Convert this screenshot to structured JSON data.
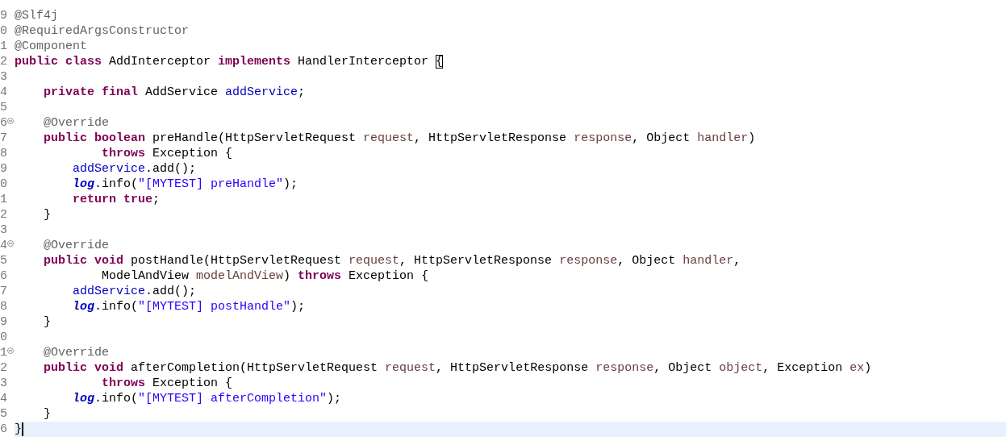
{
  "editor": {
    "lines": [
      {
        "number": "9",
        "tokens": [
          {
            "kind": "annotation",
            "text": "@Slf4j"
          }
        ]
      },
      {
        "number": "0",
        "tokens": [
          {
            "kind": "annotation",
            "text": "@RequiredArgsConstructor"
          }
        ]
      },
      {
        "number": "1",
        "tokens": [
          {
            "kind": "annotation",
            "text": "@Component"
          }
        ]
      },
      {
        "number": "2",
        "tokens": [
          {
            "kind": "keyword",
            "text": "public class"
          },
          {
            "kind": "plain",
            "text": " AddInterceptor "
          },
          {
            "kind": "keyword",
            "text": "implements"
          },
          {
            "kind": "plain",
            "text": " HandlerInterceptor "
          },
          {
            "kind": "matched_bracket",
            "text": "{"
          }
        ]
      },
      {
        "number": "3"
      },
      {
        "number": "4",
        "tokens": [
          {
            "kind": "keyword",
            "text": "    private final"
          },
          {
            "kind": "plain",
            "text": " AddService "
          },
          {
            "kind": "field",
            "text": "addService"
          },
          {
            "kind": "plain",
            "text": ";"
          }
        ]
      },
      {
        "number": "5"
      },
      {
        "number": "6",
        "collapsible": true,
        "tokens": [
          {
            "kind": "annotation",
            "text": "    @Override"
          }
        ]
      },
      {
        "number": "7",
        "tokens": [
          {
            "kind": "keyword",
            "text": "    public boolean"
          },
          {
            "kind": "plain",
            "text": " preHandle(HttpServletRequest "
          },
          {
            "kind": "param",
            "text": "request"
          },
          {
            "kind": "plain",
            "text": ", HttpServletResponse "
          },
          {
            "kind": "param",
            "text": "response"
          },
          {
            "kind": "plain",
            "text": ", Object "
          },
          {
            "kind": "param",
            "text": "handler"
          },
          {
            "kind": "plain",
            "text": ")"
          }
        ]
      },
      {
        "number": "8",
        "tokens": [
          {
            "kind": "keyword",
            "text": "            throws"
          },
          {
            "kind": "plain",
            "text": " Exception {"
          }
        ]
      },
      {
        "number": "9",
        "tokens": [
          {
            "kind": "field",
            "text": "        addService"
          },
          {
            "kind": "plain",
            "text": ".add();"
          }
        ]
      },
      {
        "number": "0",
        "tokens": [
          {
            "kind": "static",
            "text": "        log"
          },
          {
            "kind": "plain",
            "text": ".info("
          },
          {
            "kind": "string",
            "text": "\"[MYTEST] preHandle\""
          },
          {
            "kind": "plain",
            "text": ");"
          }
        ]
      },
      {
        "number": "1",
        "tokens": [
          {
            "kind": "keyword",
            "text": "        return true"
          },
          {
            "kind": "plain",
            "text": ";"
          }
        ]
      },
      {
        "number": "2",
        "tokens": [
          {
            "kind": "plain",
            "text": "    }"
          }
        ]
      },
      {
        "number": "3"
      },
      {
        "number": "4",
        "collapsible": true,
        "tokens": [
          {
            "kind": "annotation",
            "text": "    @Override"
          }
        ]
      },
      {
        "number": "5",
        "tokens": [
          {
            "kind": "keyword",
            "text": "    public void"
          },
          {
            "kind": "plain",
            "text": " postHandle(HttpServletRequest "
          },
          {
            "kind": "param",
            "text": "request"
          },
          {
            "kind": "plain",
            "text": ", HttpServletResponse "
          },
          {
            "kind": "param",
            "text": "response"
          },
          {
            "kind": "plain",
            "text": ", Object "
          },
          {
            "kind": "param",
            "text": "handler"
          },
          {
            "kind": "plain",
            "text": ","
          }
        ]
      },
      {
        "number": "6",
        "tokens": [
          {
            "kind": "plain",
            "text": "            ModelAndView "
          },
          {
            "kind": "param",
            "text": "modelAndView"
          },
          {
            "kind": "plain",
            "text": ") "
          },
          {
            "kind": "keyword",
            "text": "throws"
          },
          {
            "kind": "plain",
            "text": " Exception {"
          }
        ]
      },
      {
        "number": "7",
        "tokens": [
          {
            "kind": "field",
            "text": "        addService"
          },
          {
            "kind": "plain",
            "text": ".add();"
          }
        ]
      },
      {
        "number": "8",
        "tokens": [
          {
            "kind": "static",
            "text": "        log"
          },
          {
            "kind": "plain",
            "text": ".info("
          },
          {
            "kind": "string",
            "text": "\"[MYTEST] postHandle\""
          },
          {
            "kind": "plain",
            "text": ");"
          }
        ]
      },
      {
        "number": "9",
        "tokens": [
          {
            "kind": "plain",
            "text": "    }"
          }
        ]
      },
      {
        "number": "0"
      },
      {
        "number": "1",
        "collapsible": true,
        "tokens": [
          {
            "kind": "annotation",
            "text": "    @Override"
          }
        ]
      },
      {
        "number": "2",
        "tokens": [
          {
            "kind": "keyword",
            "text": "    public void"
          },
          {
            "kind": "plain",
            "text": " afterCompletion(HttpServletRequest "
          },
          {
            "kind": "param",
            "text": "request"
          },
          {
            "kind": "plain",
            "text": ", HttpServletResponse "
          },
          {
            "kind": "param",
            "text": "response"
          },
          {
            "kind": "plain",
            "text": ", Object "
          },
          {
            "kind": "param",
            "text": "object"
          },
          {
            "kind": "plain",
            "text": ", Exception "
          },
          {
            "kind": "param",
            "text": "ex"
          },
          {
            "kind": "plain",
            "text": ")"
          }
        ]
      },
      {
        "number": "3",
        "tokens": [
          {
            "kind": "keyword",
            "text": "            throws"
          },
          {
            "kind": "plain",
            "text": " Exception {"
          }
        ]
      },
      {
        "number": "4",
        "tokens": [
          {
            "kind": "static",
            "text": "        log"
          },
          {
            "kind": "plain",
            "text": ".info("
          },
          {
            "kind": "string",
            "text": "\"[MYTEST] afterCompletion\""
          },
          {
            "kind": "plain",
            "text": ");"
          }
        ]
      },
      {
        "number": "5",
        "tokens": [
          {
            "kind": "plain",
            "text": "    }"
          }
        ]
      },
      {
        "number": "6",
        "current": true,
        "tokens": [
          {
            "kind": "plain",
            "text": "}"
          }
        ]
      }
    ]
  }
}
